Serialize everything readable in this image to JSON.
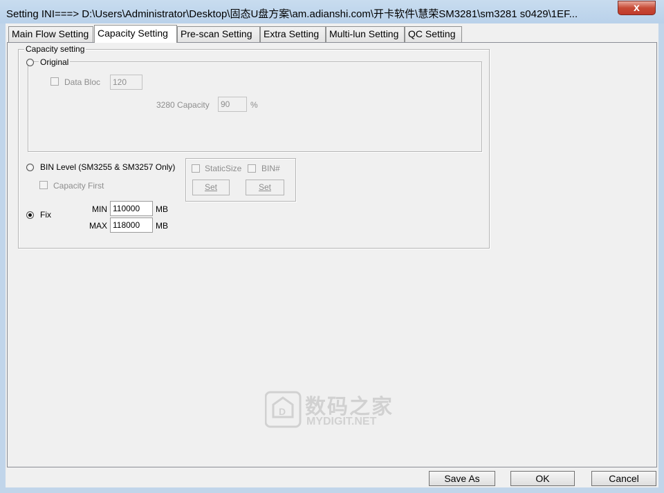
{
  "window": {
    "title": "Setting  INI===> D:\\Users\\Administrator\\Desktop\\固态U盘方案\\am.adianshi.com\\开卡软件\\慧荣SM3281\\sm3281 s0429\\1EF...",
    "close_glyph": "x"
  },
  "tabs": [
    {
      "label": "Main Flow Setting"
    },
    {
      "label": "Capacity Setting"
    },
    {
      "label": "Pre-scan Setting"
    },
    {
      "label": "Extra Setting"
    },
    {
      "label": "Multi-lun Setting"
    },
    {
      "label": "QC Setting"
    }
  ],
  "active_tab": "Capacity Setting",
  "capacity": {
    "group_label": "Capacity setting",
    "original": {
      "label": "Original",
      "selected": false,
      "data_bloc_label": "Data Bloc",
      "data_bloc_value": "120",
      "capacity_3280_label": "3280 Capacity",
      "capacity_3280_value": "90",
      "percent_unit": "%"
    },
    "bin_level": {
      "label": "BIN Level (SM3255 & SM3257 Only)",
      "selected": false,
      "capacity_first_label": "Capacity First",
      "static_size_label": "StaticSize",
      "bin_label": "BIN#",
      "set_label_1": "Set",
      "set_label_2": "Set"
    },
    "fix": {
      "label": "Fix",
      "selected": true,
      "min_label": "MIN",
      "min_value": "110000",
      "max_label": "MAX",
      "max_value": "118000",
      "unit": "MB"
    }
  },
  "footer": {
    "save_as_label": "Save  As",
    "ok_label": "OK",
    "cancel_label": "Cancel"
  },
  "watermark": {
    "cn_text": "数码之家",
    "en_text": "MYDIGIT.NET"
  },
  "colors": {
    "title_bar": "#b9d1ea",
    "close_button": "#c74b36",
    "background": "#f0f0f0"
  }
}
